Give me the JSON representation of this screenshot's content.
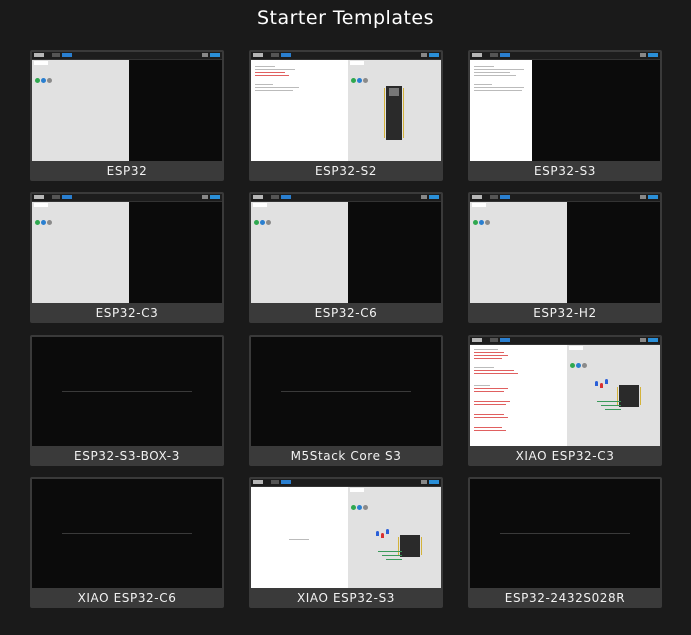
{
  "page": {
    "title": "Starter Templates"
  },
  "templates": [
    {
      "label": "ESP32"
    },
    {
      "label": "ESP32-S2"
    },
    {
      "label": "ESP32-S3"
    },
    {
      "label": "ESP32-C3"
    },
    {
      "label": "ESP32-C6"
    },
    {
      "label": "ESP32-H2"
    },
    {
      "label": "ESP32-S3-BOX-3"
    },
    {
      "label": "M5Stack Core S3"
    },
    {
      "label": "XIAO ESP32-C3"
    },
    {
      "label": "XIAO ESP32-C6"
    },
    {
      "label": "XIAO ESP32-S3"
    },
    {
      "label": "ESP32-2432S028R"
    }
  ],
  "colors": {
    "background": "#1a1a1a",
    "card": "#3a3a3a",
    "preview_dark": "#0b0b0b",
    "accent_blue": "#2a7fd0",
    "run_green": "#2fa84f"
  }
}
